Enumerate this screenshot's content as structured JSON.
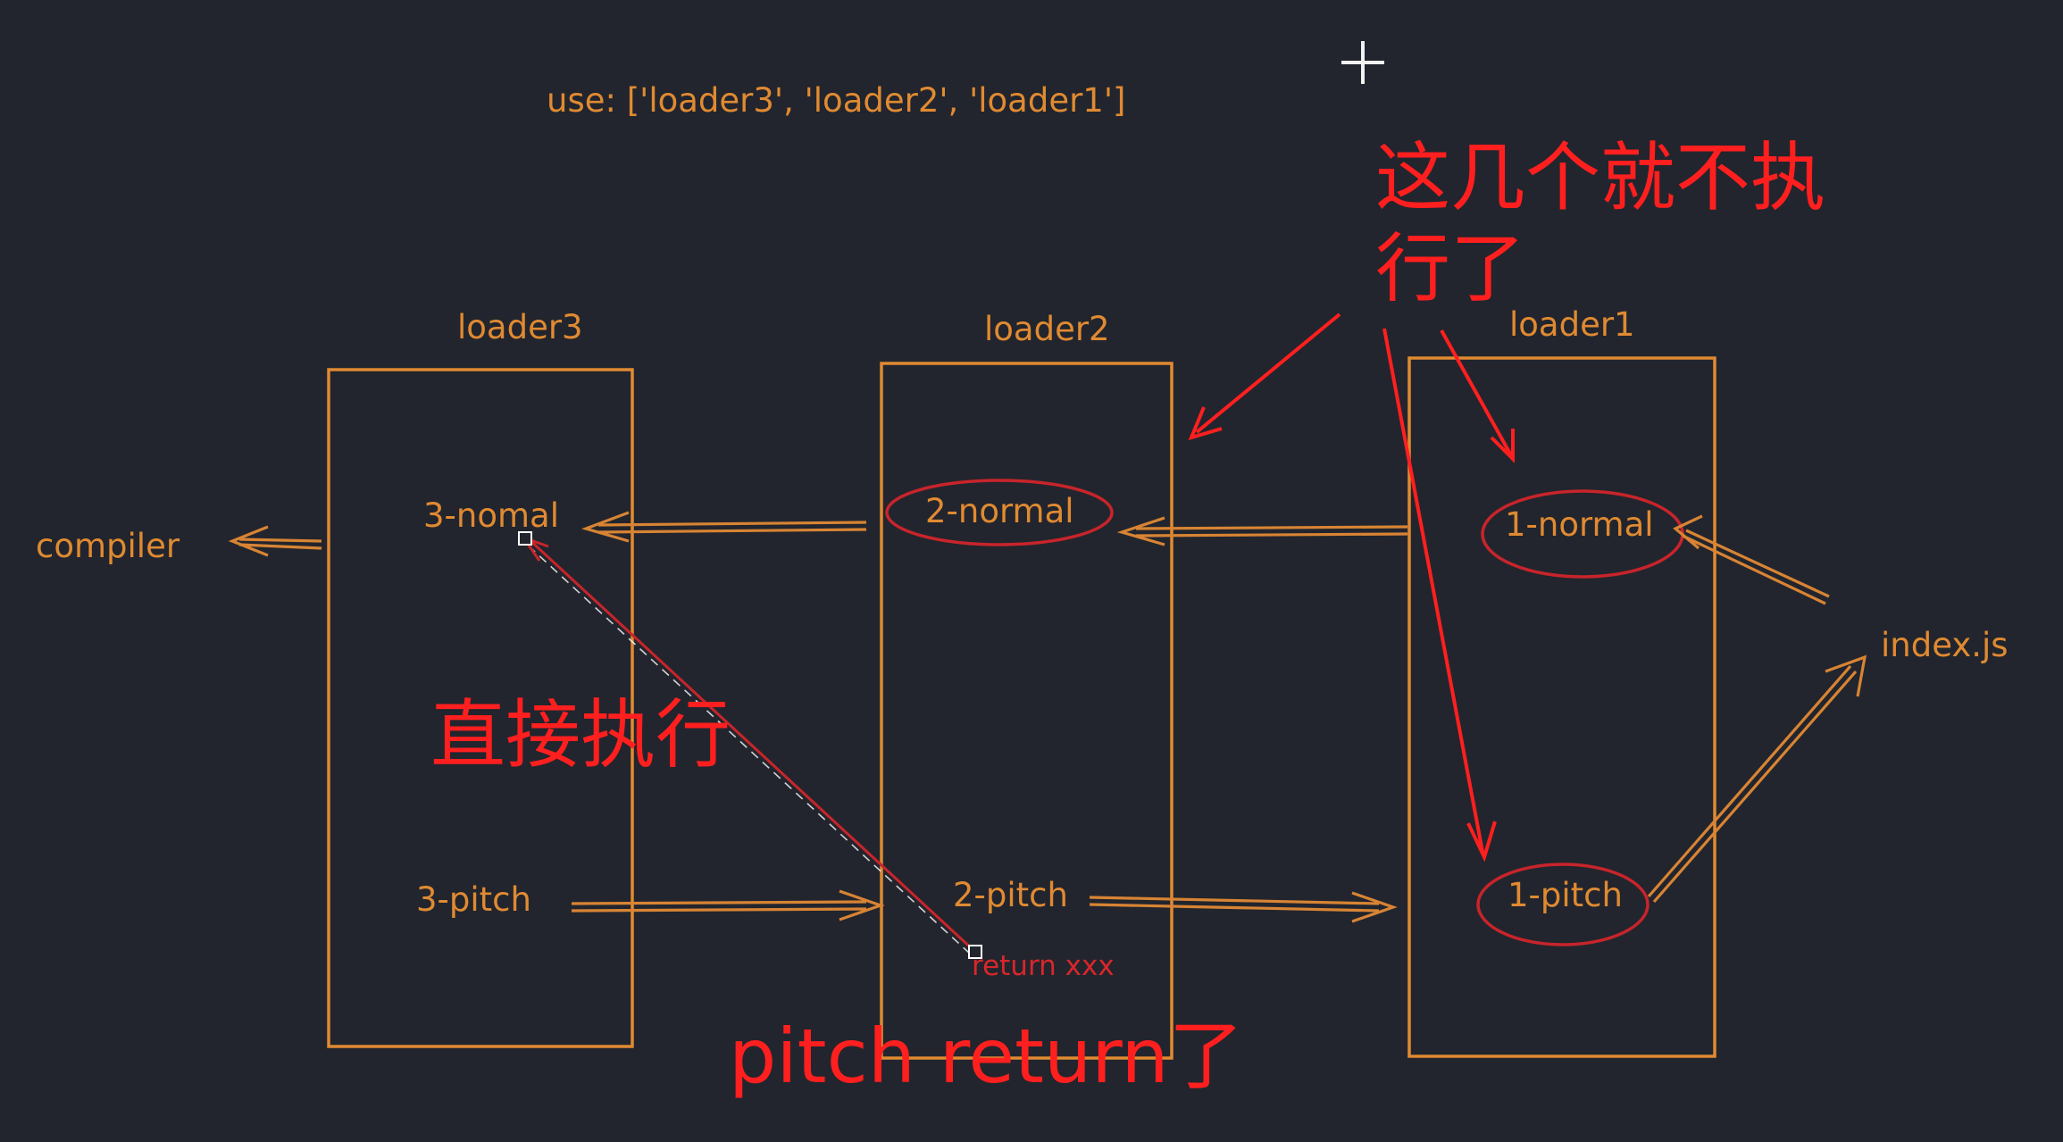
{
  "use_line": "use: ['loader3', 'loader2', 'loader1']",
  "loaders": [
    {
      "id": "loader3",
      "title": "loader3",
      "normal": "3-nomal",
      "pitch": "3-pitch"
    },
    {
      "id": "loader2",
      "title": "loader2",
      "normal": "2-normal",
      "pitch": "2-pitch",
      "return_note": "return xxx"
    },
    {
      "id": "loader1",
      "title": "loader1",
      "normal": "1-normal",
      "pitch": "1-pitch"
    }
  ],
  "compiler_label": "compiler",
  "entry_label": "index.js",
  "annotations": {
    "skip_line1": "这几个就不执",
    "skip_line2": "行了",
    "direct_exec": "直接执行",
    "pitch_return": "pitch return了"
  },
  "colors": {
    "background": "#22252d",
    "orange": "#e08a32",
    "red": "#ff1f1f",
    "ellipse_red": "#c8242b"
  }
}
